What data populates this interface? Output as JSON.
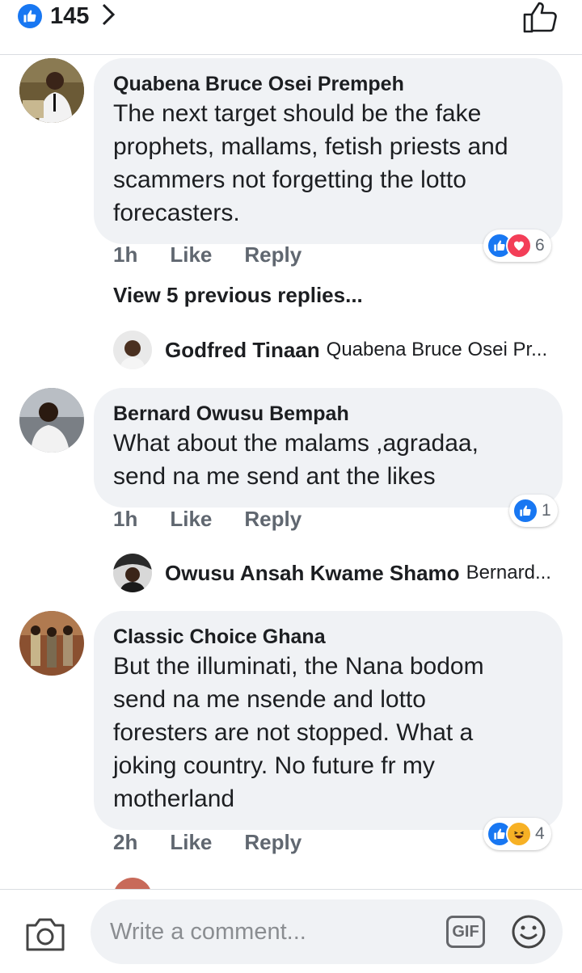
{
  "header": {
    "like_count": "145"
  },
  "comments": [
    {
      "author": "Quabena Bruce Osei Prempeh",
      "lines": [
        "The next target should be the fake",
        "prophets, mallams, fetish priests and",
        "scammers not forgetting the lotto",
        "forecasters."
      ],
      "time": "1h",
      "like_label": "Like",
      "reply_label": "Reply",
      "reaction_count": "6",
      "reaction_icons": [
        "like-icon",
        "love-icon"
      ]
    },
    {
      "author": "Bernard Owusu Bempah",
      "lines": [
        "What about the malams ,agradaa,",
        "send na me send ant the likes"
      ],
      "time": "1h",
      "like_label": "Like",
      "reply_label": "Reply",
      "reaction_count": "1",
      "reaction_icons": [
        "like-icon"
      ]
    },
    {
      "author": "Classic Choice Ghana",
      "lines": [
        "But the illuminati, the Nana bodom",
        "send na me nsende and lotto",
        "foresters are not stopped. What a",
        "joking country. No future fr my",
        "motherland"
      ],
      "time": "2h",
      "like_label": "Like",
      "reply_label": "Reply",
      "reaction_count": "4",
      "reaction_icons": [
        "like-icon",
        "haha-icon"
      ]
    }
  ],
  "view_previous_replies": "View 5 previous replies...",
  "replies": [
    {
      "author": "Godfred Tinaan",
      "snippet": "Quabena Bruce Osei Pr..."
    },
    {
      "author": "Owusu Ansah Kwame Shamo",
      "snippet": "Bernard..."
    }
  ],
  "footer": {
    "placeholder": "Write a comment...",
    "gif_label": "GIF"
  },
  "colors": {
    "like_blue": "#1877f2",
    "love_red": "#f33e58",
    "haha_yellow": "#f7b125",
    "bubble_bg": "#f0f2f5",
    "meta_gray": "#606770"
  }
}
